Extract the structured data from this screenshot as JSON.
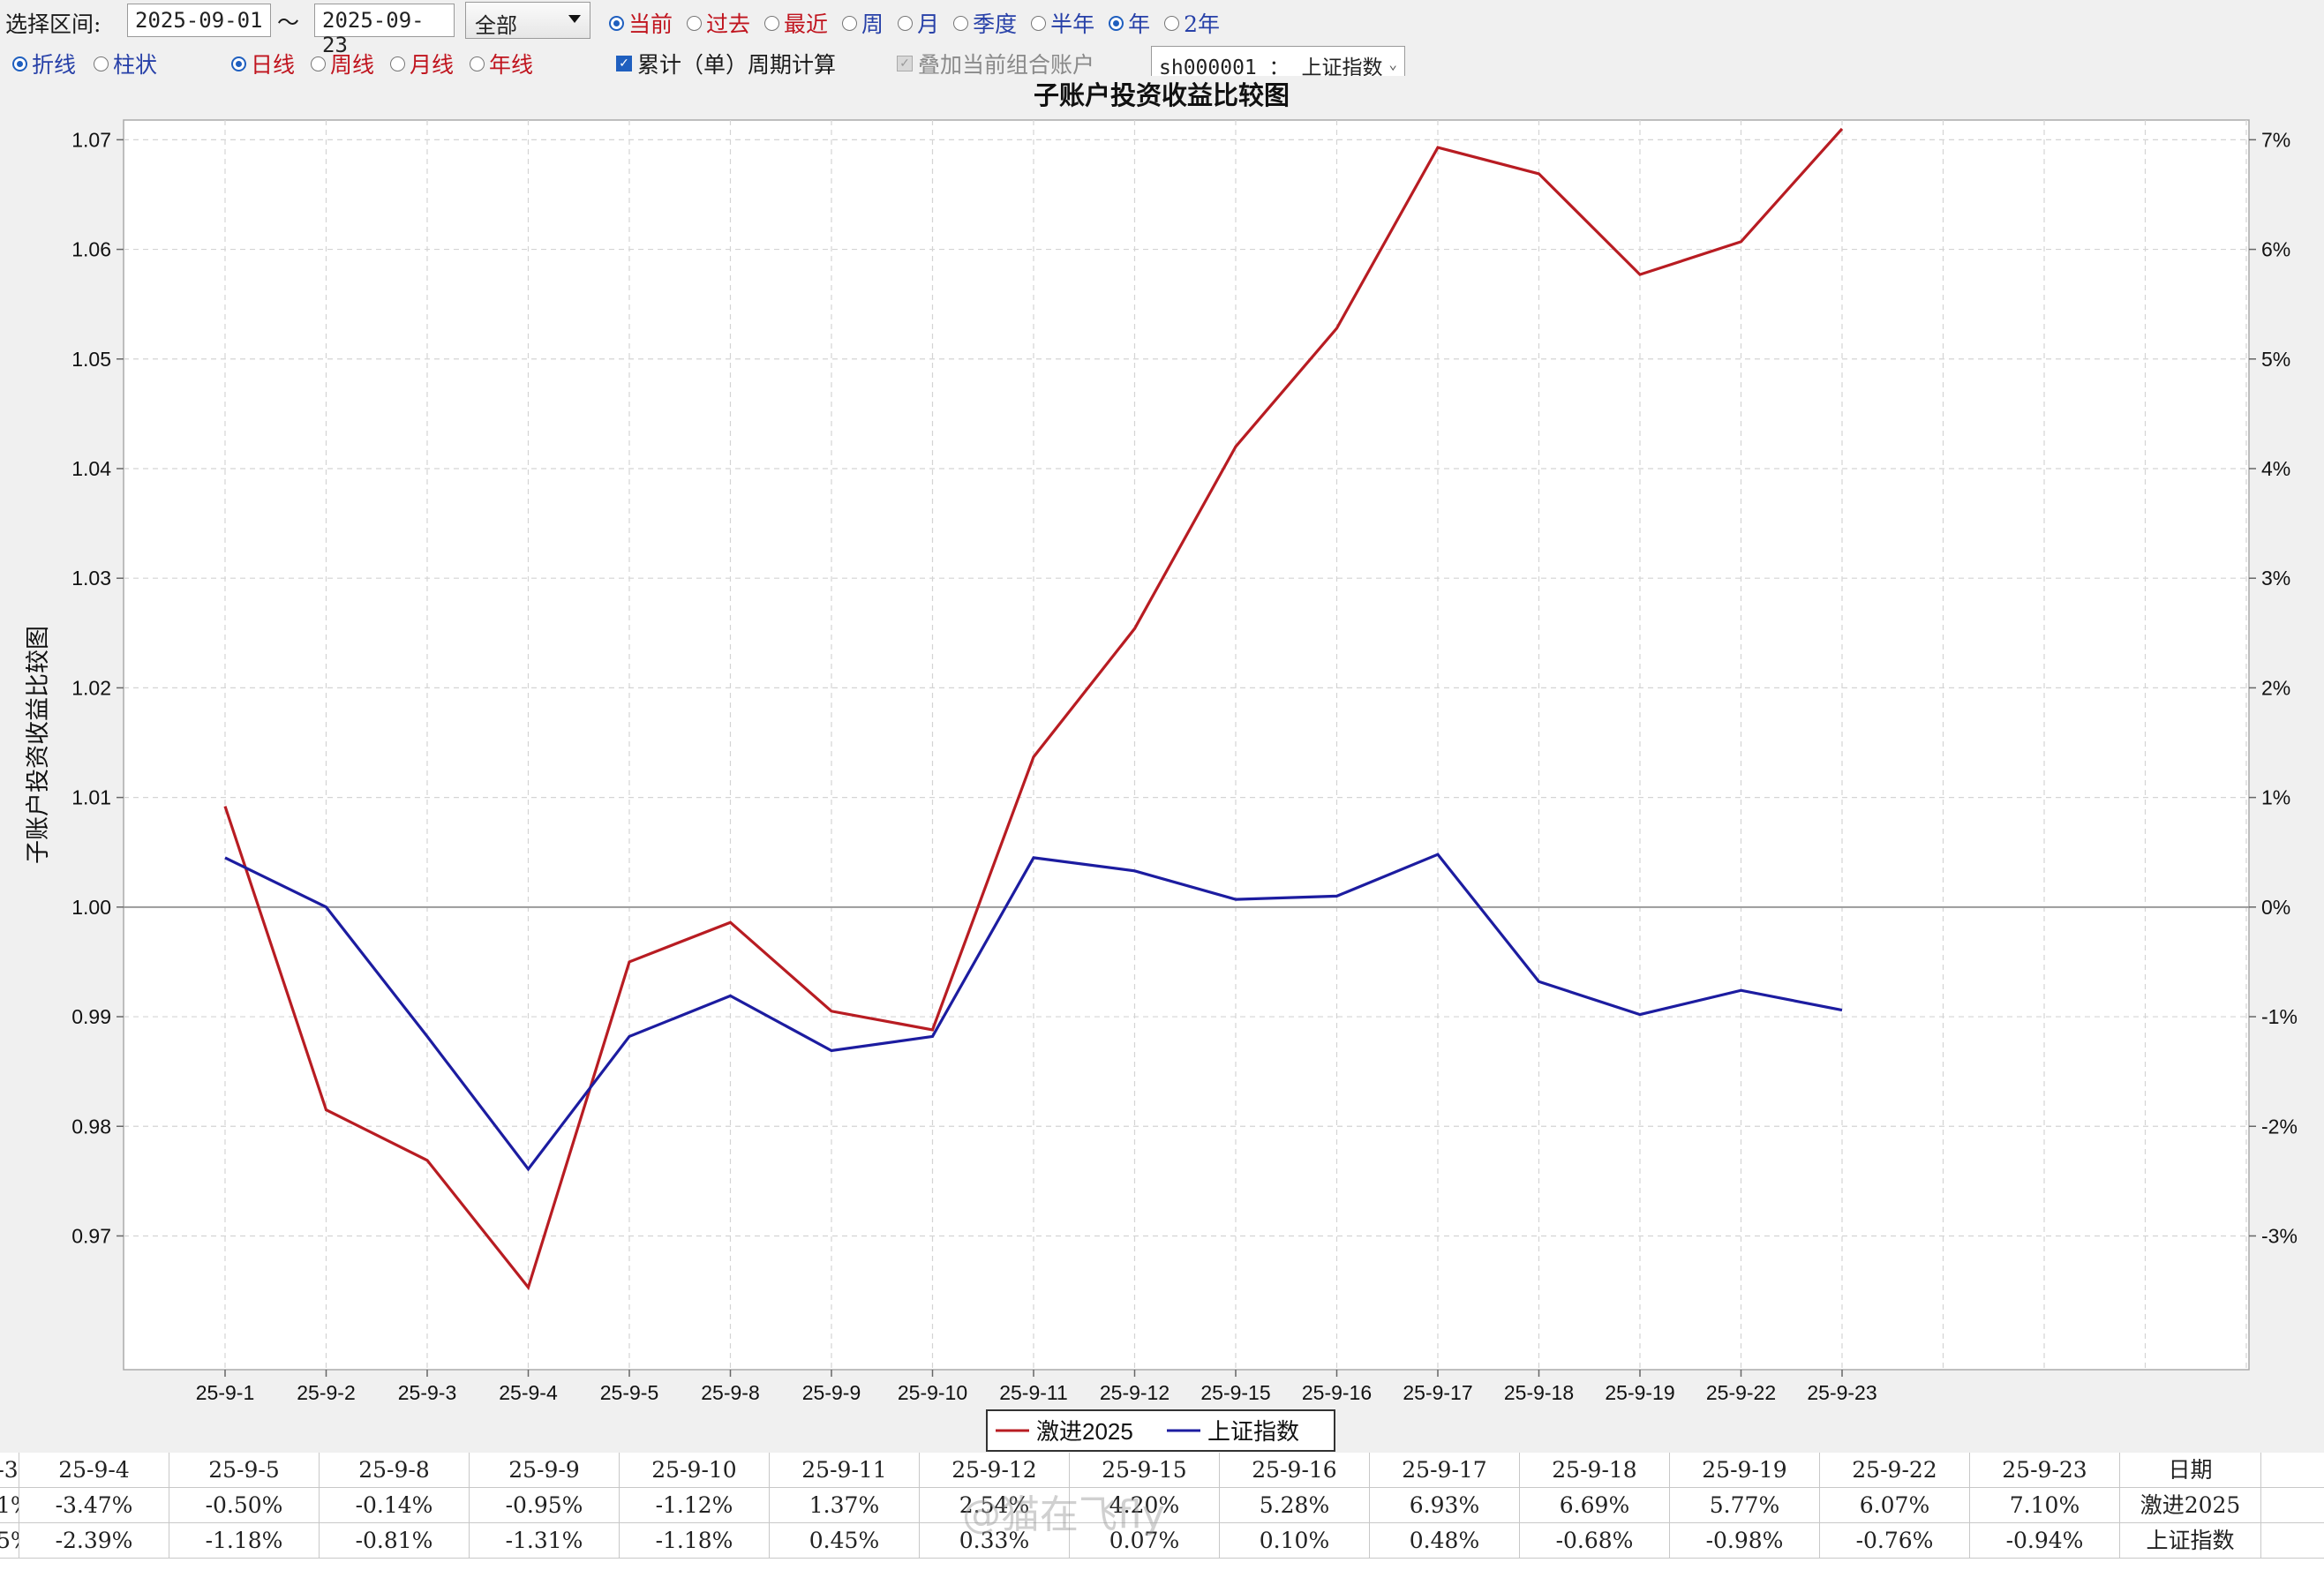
{
  "toolbar": {
    "range_label": "选择区间:",
    "start_date": "2025-09-01",
    "tilde": "～",
    "end_date": "2025-09-23",
    "account_select": "全部",
    "period_radios": [
      {
        "label": "当前",
        "checked": true,
        "color": "red"
      },
      {
        "label": "过去",
        "checked": false,
        "color": "red"
      },
      {
        "label": "最近",
        "checked": false,
        "color": "red"
      },
      {
        "label": "周",
        "checked": false,
        "color": "blue"
      },
      {
        "label": "月",
        "checked": false,
        "color": "blue"
      },
      {
        "label": "季度",
        "checked": false,
        "color": "blue"
      },
      {
        "label": "半年",
        "checked": false,
        "color": "blue"
      },
      {
        "label": "年",
        "checked": true,
        "color": "blue"
      },
      {
        "label": "2年",
        "checked": false,
        "color": "blue"
      }
    ],
    "chart_type_radios": [
      {
        "label": "折线",
        "checked": true
      },
      {
        "label": "柱状",
        "checked": false
      }
    ],
    "interval_radios": [
      {
        "label": "日线",
        "checked": true
      },
      {
        "label": "周线",
        "checked": false
      },
      {
        "label": "月线",
        "checked": false
      },
      {
        "label": "年线",
        "checked": false
      }
    ],
    "cumulative_checkbox": "累计（单）周期计算",
    "overlay_checkbox": "叠加当前组合账户",
    "index_select": "sh000001 ： 上证指数"
  },
  "chart_data": {
    "type": "line",
    "title": "子账户投资收益比较图",
    "ylabel": "子账户投资收益比较图",
    "x": [
      "25-9-1",
      "25-9-2",
      "25-9-3",
      "25-9-4",
      "25-9-5",
      "25-9-8",
      "25-9-9",
      "25-9-10",
      "25-9-11",
      "25-9-12",
      "25-9-15",
      "25-9-16",
      "25-9-17",
      "25-9-18",
      "25-9-19",
      "25-9-22",
      "25-9-23"
    ],
    "ylim": [
      0.9578,
      1.0718
    ],
    "y_ticks": [
      "0.97",
      "0.98",
      "0.99",
      "1.00",
      "1.01",
      "1.02",
      "1.03",
      "1.04",
      "1.05",
      "1.06",
      "1.07"
    ],
    "y_ticks_right": [
      "-3%",
      "-2%",
      "-1%",
      "0%",
      "1%",
      "2%",
      "3%",
      "4%",
      "5%",
      "6%",
      "7%"
    ],
    "grid": true,
    "legend_position": "bottom-center",
    "series": [
      {
        "name": "激进2025",
        "color": "#b81c22",
        "values": [
          1.0092,
          0.9815,
          0.9769,
          0.9653,
          0.995,
          0.9986,
          0.9905,
          0.9888,
          1.0137,
          1.0254,
          1.042,
          1.0528,
          1.0693,
          1.0669,
          1.0577,
          1.0607,
          1.071
        ]
      },
      {
        "name": "上证指数",
        "color": "#1c1ca0",
        "values": [
          1.0045,
          1.0,
          0.9882,
          0.9761,
          0.9882,
          0.9919,
          0.9869,
          0.9882,
          1.0045,
          1.0033,
          1.0007,
          1.001,
          1.0048,
          0.9932,
          0.9902,
          0.9924,
          0.9906
        ]
      }
    ]
  },
  "table": {
    "columns": [
      "-3",
      "25-9-4",
      "25-9-5",
      "25-9-8",
      "25-9-9",
      "25-9-10",
      "25-9-11",
      "25-9-12",
      "25-9-15",
      "25-9-16",
      "25-9-17",
      "25-9-18",
      "25-9-19",
      "25-9-22",
      "25-9-23",
      "日期"
    ],
    "row1": [
      "1%",
      "-3.47%",
      "-0.50%",
      "-0.14%",
      "-0.95%",
      "-1.12%",
      "1.37%",
      "2.54%",
      "4.20%",
      "5.28%",
      "6.93%",
      "6.69%",
      "5.77%",
      "6.07%",
      "7.10%",
      "激进2025"
    ],
    "row2": [
      "5%",
      "-2.39%",
      "-1.18%",
      "-0.81%",
      "-1.31%",
      "-1.18%",
      "0.45%",
      "0.33%",
      "0.07%",
      "0.10%",
      "0.48%",
      "-0.68%",
      "-0.98%",
      "-0.76%",
      "-0.94%",
      "上证指数"
    ]
  },
  "watermark": "@猫在飞fly"
}
